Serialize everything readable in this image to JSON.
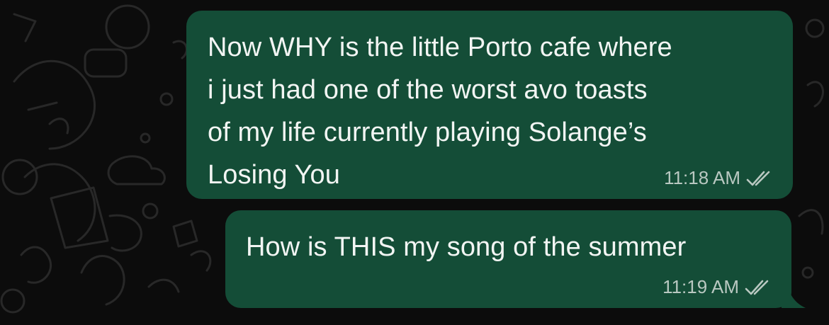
{
  "conversation": {
    "messages": [
      {
        "text": "Now WHY is the little Porto cafe where\ni just had one of the worst avo toasts\nof my life currently playing Solange’s\nLosing You",
        "time": "11:18 AM",
        "status_icon": "double-check-icon",
        "direction": "outgoing"
      },
      {
        "text": "How is THIS my song of the summer",
        "time": "11:19 AM",
        "status_icon": "double-check-icon",
        "direction": "outgoing"
      }
    ]
  },
  "colors": {
    "background": "#0c0c0c",
    "bubble": "#144d37",
    "text": "#f2f5f3",
    "meta": "#b9c8c1"
  }
}
